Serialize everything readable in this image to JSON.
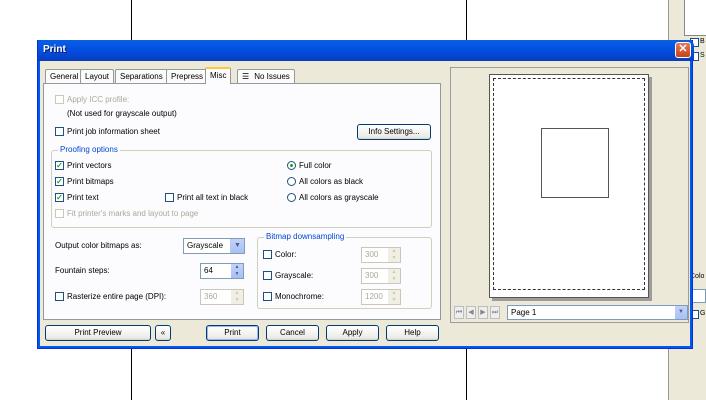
{
  "dialog": {
    "title": "Print",
    "close_symbol": "✕"
  },
  "tabs": [
    {
      "label": "General"
    },
    {
      "label": "Layout"
    },
    {
      "label": "Separations"
    },
    {
      "label": "Prepress"
    },
    {
      "label": "Misc",
      "active": true
    },
    {
      "label": "No Issues",
      "icon": "issues-icon"
    }
  ],
  "misc": {
    "apply_icc": "Apply ICC profile:",
    "icc_note": "(Not used for grayscale output)",
    "print_job_info": "Print job information sheet",
    "info_settings_button": "Info Settings...",
    "proofing_title": "Proofing options",
    "print_vectors": "Print vectors",
    "print_bitmaps": "Print bitmaps",
    "print_text": "Print text",
    "print_all_text_black": "Print all text in black",
    "fit_marks": "Fit printer's marks and layout to page",
    "full_color": "Full color",
    "all_colors_black": "All colors as black",
    "all_colors_grayscale": "All colors as grayscale",
    "output_bitmaps_label": "Output color bitmaps as:",
    "output_bitmaps_value": "Grayscale",
    "fountain_steps_label": "Fountain steps:",
    "fountain_steps_value": "64",
    "rasterize_label": "Rasterize entire page (DPI):",
    "rasterize_value": "360",
    "downsampling_title": "Bitmap downsampling",
    "color_label": "Color:",
    "color_value": "300",
    "grayscale_label": "Grayscale:",
    "grayscale_value": "300",
    "monochrome_label": "Monochrome:",
    "monochrome_value": "1200"
  },
  "footer": {
    "print_preview": "Print Preview",
    "collapse_symbol": "«",
    "print": "Print",
    "cancel": "Cancel",
    "apply": "Apply",
    "help": "Help"
  },
  "preview": {
    "page_select": "Page 1",
    "nav": [
      "⏮",
      "◀",
      "▶",
      "⏭"
    ]
  },
  "background": {
    "checkbox1": "B",
    "checkbox2": "S",
    "label1": "Colo",
    "label2": "G"
  }
}
